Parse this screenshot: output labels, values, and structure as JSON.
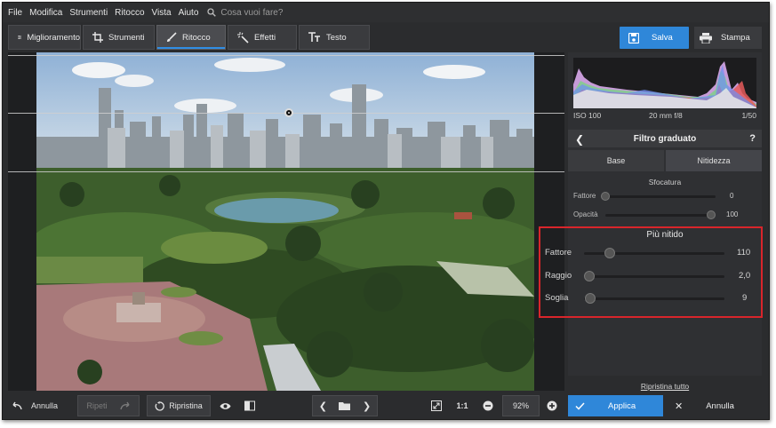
{
  "menu": {
    "items": [
      "File",
      "Modifica",
      "Strumenti",
      "Ritocco",
      "Vista",
      "Aiuto"
    ],
    "search_placeholder": "Cosa vuoi fare?"
  },
  "tabs": [
    {
      "label": "Miglioramento",
      "icon": "sliders-icon"
    },
    {
      "label": "Strumenti",
      "icon": "crop-icon"
    },
    {
      "label": "Ritocco",
      "icon": "brush-icon",
      "active": true
    },
    {
      "label": "Effetti",
      "icon": "magic-wand-icon"
    },
    {
      "label": "Testo",
      "icon": "text-icon"
    }
  ],
  "actions": {
    "save": "Salva",
    "print": "Stampa"
  },
  "exif": {
    "iso": "ISO 100",
    "lens": "20 mm f/8",
    "shutter": "1/50"
  },
  "panel": {
    "title": "Filtro graduato",
    "help": "?",
    "tabs": {
      "base": "Base",
      "sharpness": "Nitidezza"
    },
    "blur": {
      "label": "Sfocatura",
      "sliders": [
        {
          "label": "Fattore",
          "value": "0",
          "fraction": 0.0
        },
        {
          "label": "Opacità",
          "value": "100",
          "fraction": 1.0
        }
      ]
    },
    "sharper": {
      "label": "Più nitido",
      "sliders": [
        {
          "label": "Fattore",
          "value": "110",
          "fraction": 0.18
        },
        {
          "label": "Raggio",
          "value": "2,0",
          "fraction": 0.0
        },
        {
          "label": "Soglia",
          "value": "9",
          "fraction": 0.01
        }
      ]
    },
    "reset_all": "Ripristina tutto"
  },
  "bottom": {
    "undo": "Annulla",
    "redo": "Ripeti",
    "restore": "Ripristina",
    "ratio": "1:1",
    "zoom": "92%",
    "apply": "Applica",
    "cancel": "Annulla"
  },
  "colors": {
    "accent": "#2f87d9",
    "highlight_box": "#d9252b",
    "bg": "#2b2c2e",
    "panel": "#2f3033"
  }
}
